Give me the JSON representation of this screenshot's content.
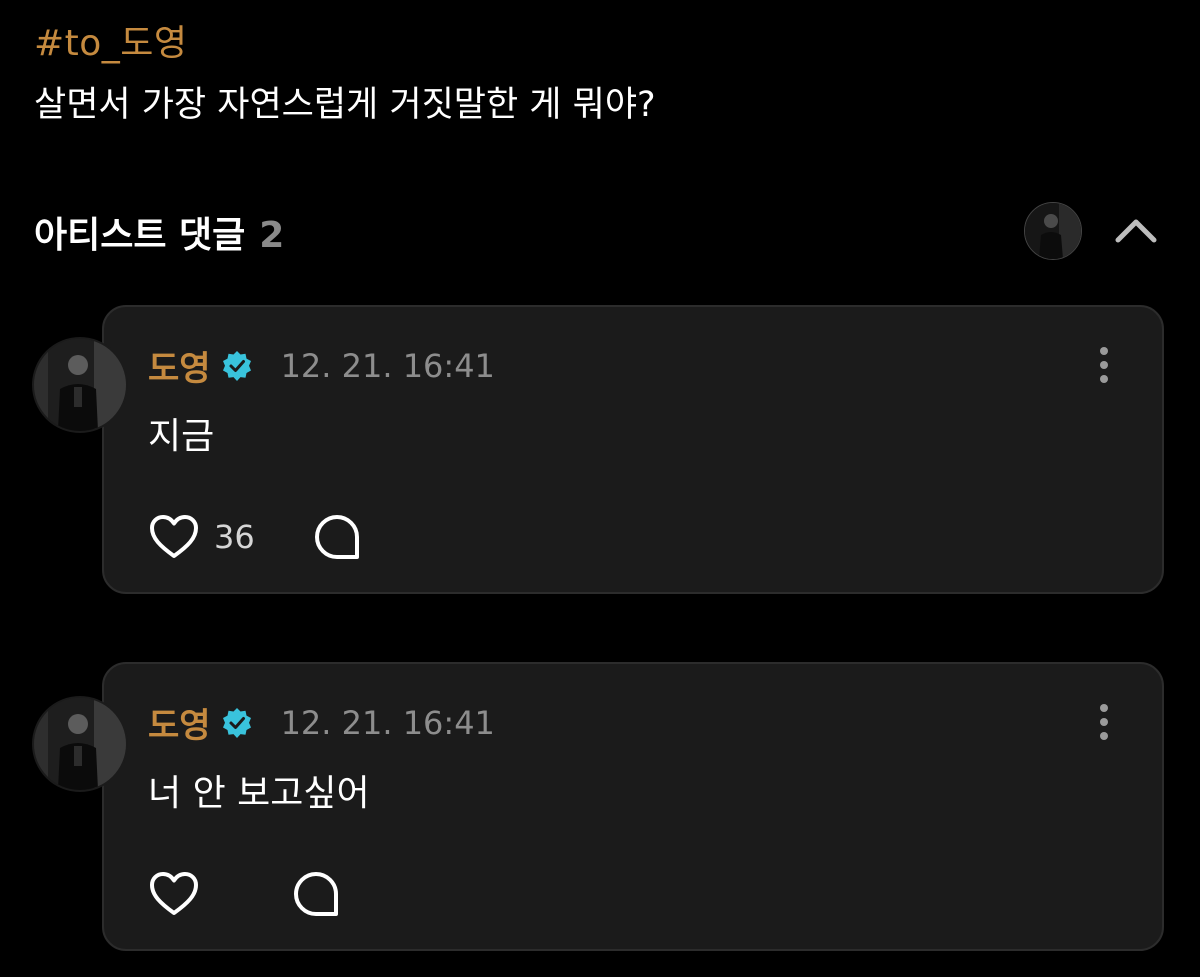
{
  "post": {
    "hashtag": "#to_도영",
    "question": "살면서 가장 자연스럽게 거짓말한 게 뭐야?"
  },
  "section": {
    "title": "아티스트 댓글",
    "count": "2",
    "collapse_icon": "chevron-up-icon"
  },
  "comments": [
    {
      "author": "도영",
      "verified_icon": "verified-badge-icon",
      "timestamp": "12. 21. 16:41",
      "text": "지금",
      "like_count": "36"
    },
    {
      "author": "도영",
      "verified_icon": "verified-badge-icon",
      "timestamp": "12. 21. 16:41",
      "text": "너 안 보고싶어",
      "like_count": ""
    }
  ],
  "colors": {
    "background": "#000000",
    "card": "#1b1b1b",
    "accent": "#c58a3f",
    "verified": "#39c3dc",
    "muted": "#8d8d8d"
  }
}
